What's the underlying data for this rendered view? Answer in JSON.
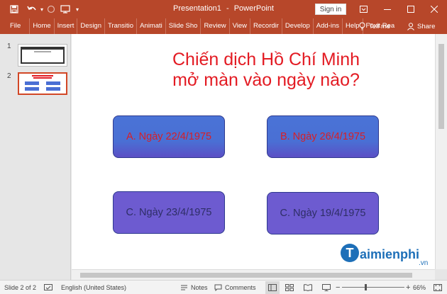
{
  "window": {
    "title": "Presentation1",
    "separator": "-",
    "app": "PowerPoint",
    "signin_label": "Sign in",
    "accent": "#b7472a"
  },
  "ribbon": {
    "tabs": [
      "File",
      "Home",
      "Insert",
      "Design",
      "Transitio",
      "Animati",
      "Slide Sho",
      "Review",
      "View",
      "Recordir",
      "Develop",
      "Add-ins",
      "Help",
      "Foxit Rea"
    ],
    "tell_me": "Tell me",
    "share": "Share"
  },
  "thumbnails": [
    {
      "number": "1"
    },
    {
      "number": "2"
    }
  ],
  "slide": {
    "title_line1": "Chiến dịch Hồ Chí Minh",
    "title_line2": "mở màn vào ngày nào?",
    "title_color": "#e31b23",
    "answers": [
      {
        "label": "A. Ngày 22/4/1975"
      },
      {
        "label": "B. Ngày 26/4/1975"
      },
      {
        "label": "C. Ngày 23/4/1975"
      },
      {
        "label": "C. Ngày 19/4/1975"
      }
    ]
  },
  "watermark": {
    "logo_letter": "T",
    "text": "aimienphi",
    "suffix": ".vn"
  },
  "statusbar": {
    "slide_indicator": "Slide 2 of 2",
    "language": "English (United States)",
    "notes": "Notes",
    "comments": "Comments",
    "zoom": "66%"
  }
}
